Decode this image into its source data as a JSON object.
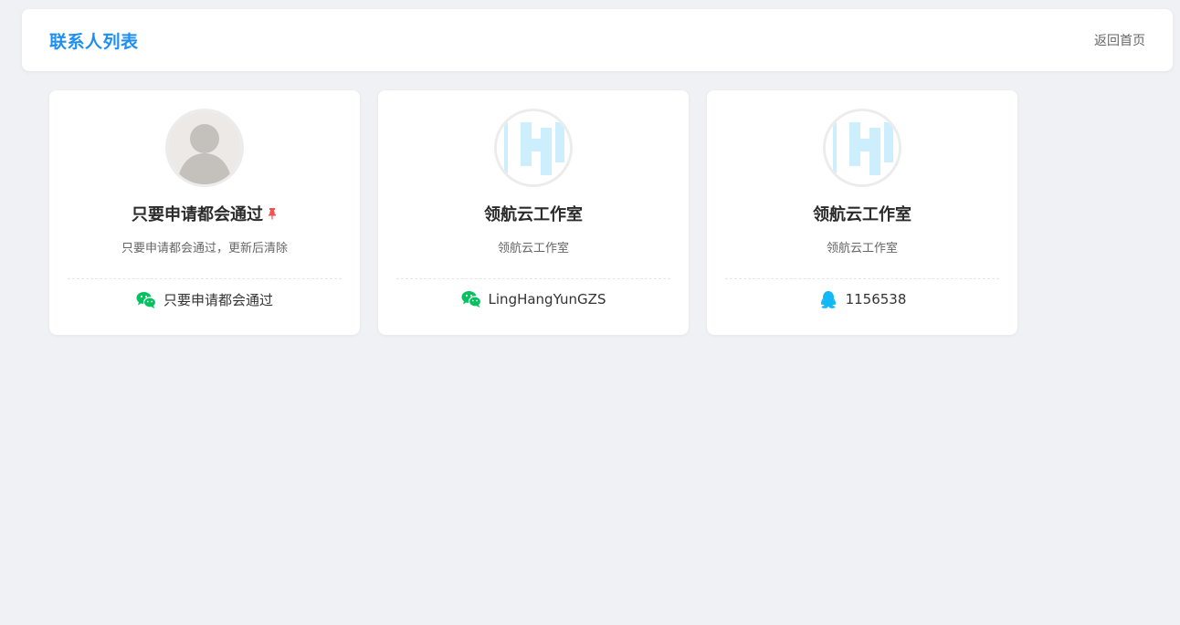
{
  "header": {
    "title": "联系人列表",
    "home_link": "返回首页"
  },
  "colors": {
    "accent": "#1e8ff0",
    "wechat": "#07c160",
    "qq": "#12b7f5",
    "pin": "#f05454"
  },
  "cards": [
    {
      "avatar": "person-placeholder",
      "name": "只要申请都会通过",
      "pinned": true,
      "desc": "只要申请都会通过，更新后清除",
      "contact_type": "wechat-icon",
      "contact_value": "只要申请都会通过"
    },
    {
      "avatar": "linghang-logo",
      "name": "领航云工作室",
      "pinned": false,
      "desc": "领航云工作室",
      "contact_type": "wechat-icon",
      "contact_value": "LingHangYunGZS"
    },
    {
      "avatar": "linghang-logo",
      "name": "领航云工作室",
      "pinned": false,
      "desc": "领航云工作室",
      "contact_type": "qq-icon",
      "contact_value": "1156538"
    }
  ]
}
